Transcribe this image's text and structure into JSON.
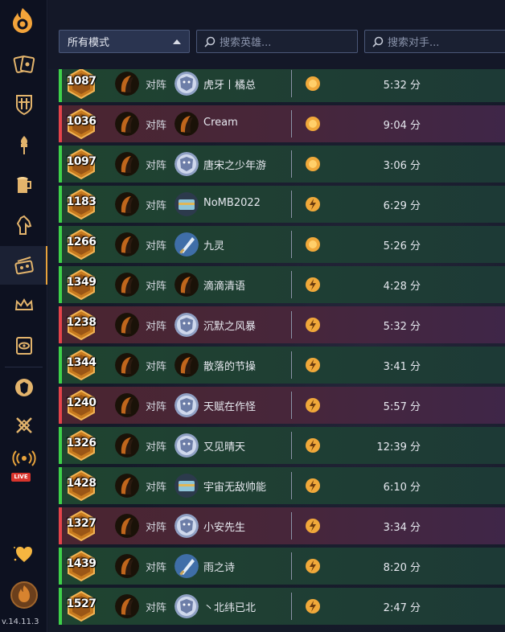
{
  "sidebar": {
    "version": "v.14.11.3",
    "live_label": "LIVE",
    "items": [
      {
        "icon": "cards-icon"
      },
      {
        "icon": "shield-grid-icon"
      },
      {
        "icon": "torch-icon"
      },
      {
        "icon": "tankard-icon"
      },
      {
        "icon": "horse-icon"
      },
      {
        "icon": "battlegrounds-icon"
      },
      {
        "icon": "crown-icon"
      },
      {
        "icon": "eye-card-icon"
      },
      {
        "icon": "hero-icon"
      },
      {
        "icon": "crossed-swords-icon"
      },
      {
        "icon": "broadcast-icon"
      },
      {
        "icon": "heart-icon"
      }
    ]
  },
  "filters": {
    "mode_select": "所有模式",
    "hero_search_placeholder": "搜索英雄...",
    "opponent_search_placeholder": "搜索对手..."
  },
  "colors": {
    "win_bar": "#3ed14a",
    "loss_bar": "#e4434a",
    "accent": "#e8a33c"
  },
  "matches": [
    {
      "rating": "1087",
      "result": "win",
      "vs": "对阵",
      "opponent": "虎牙丨橘总",
      "opp_portrait": "mage",
      "coin": "first",
      "duration": "5:32 分"
    },
    {
      "rating": "1036",
      "result": "loss",
      "vs": "对阵",
      "opponent": "Cream",
      "opp_portrait": "rogue",
      "coin": "first",
      "duration": "9:04 分"
    },
    {
      "rating": "1097",
      "result": "win",
      "vs": "对阵",
      "opponent": "唐宋之少年游",
      "opp_portrait": "mage",
      "coin": "first",
      "duration": "3:06 分"
    },
    {
      "rating": "1183",
      "result": "win",
      "vs": "对阵",
      "opponent": "NoMB2022",
      "opp_portrait": "chest",
      "coin": "second",
      "duration": "6:29 分"
    },
    {
      "rating": "1266",
      "result": "win",
      "vs": "对阵",
      "opponent": "九灵",
      "opp_portrait": "sword",
      "coin": "first",
      "duration": "5:26 分"
    },
    {
      "rating": "1349",
      "result": "win",
      "vs": "对阵",
      "opponent": "滴滴清语",
      "opp_portrait": "rogue",
      "coin": "second",
      "duration": "4:28 分"
    },
    {
      "rating": "1238",
      "result": "loss",
      "vs": "对阵",
      "opponent": "沉默之风暴",
      "opp_portrait": "mage",
      "coin": "second",
      "duration": "5:32 分"
    },
    {
      "rating": "1344",
      "result": "win",
      "vs": "对阵",
      "opponent": "散落的节操",
      "opp_portrait": "rogue",
      "coin": "second",
      "duration": "3:41 分"
    },
    {
      "rating": "1240",
      "result": "loss",
      "vs": "对阵",
      "opponent": "天赋在作怪",
      "opp_portrait": "mage",
      "coin": "second",
      "duration": "5:57 分"
    },
    {
      "rating": "1326",
      "result": "win",
      "vs": "对阵",
      "opponent": "又见晴天",
      "opp_portrait": "mage",
      "coin": "second",
      "duration": "12:39 分"
    },
    {
      "rating": "1428",
      "result": "win",
      "vs": "对阵",
      "opponent": "宇宙无敌帅能",
      "opp_portrait": "chest",
      "coin": "second",
      "duration": "6:10 分"
    },
    {
      "rating": "1327",
      "result": "loss",
      "vs": "对阵",
      "opponent": "小安先生",
      "opp_portrait": "mage",
      "coin": "second",
      "duration": "3:34 分"
    },
    {
      "rating": "1439",
      "result": "win",
      "vs": "对阵",
      "opponent": "雨之诗",
      "opp_portrait": "sword",
      "coin": "second",
      "duration": "8:20 分"
    },
    {
      "rating": "1527",
      "result": "win",
      "vs": "对阵",
      "opponent": "丶北纬已北",
      "opp_portrait": "mage",
      "coin": "second",
      "duration": "2:47 分"
    }
  ]
}
